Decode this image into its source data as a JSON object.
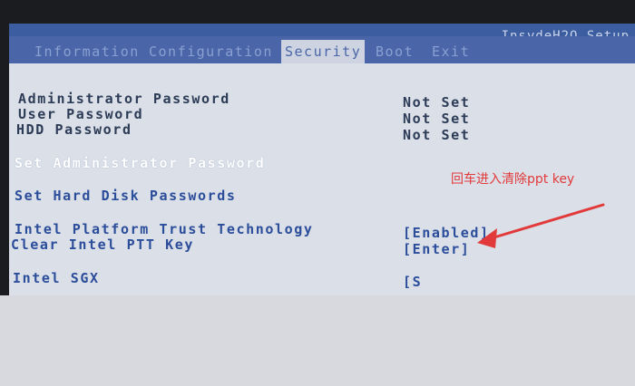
{
  "vendor": "InsydeH2O Setup",
  "menu": {
    "tabs": [
      {
        "label": "Information"
      },
      {
        "label": "Configuration"
      },
      {
        "label": "Security"
      },
      {
        "label": "Boot"
      },
      {
        "label": "Exit"
      }
    ],
    "active": "Security"
  },
  "security": {
    "admin_password": {
      "label": "Administrator Password",
      "value": "Not Set"
    },
    "user_password": {
      "label": "User Password",
      "value": "Not Set"
    },
    "hdd_password": {
      "label": "HDD Password",
      "value": "Not Set"
    },
    "set_admin_password": {
      "label": "Set Administrator Password"
    },
    "set_hdd_passwords": {
      "label": "Set Hard Disk Passwords"
    },
    "ptt": {
      "label": "Intel Platform Trust Technology",
      "value": "[Enabled]"
    },
    "clear_ptt": {
      "label": "Clear Intel PTT Key",
      "value": "[Enter]"
    },
    "sgx": {
      "label": "Intel SGX",
      "value": "[S"
    }
  },
  "annotation": {
    "text": "回车进入清除ppt key",
    "color": "#e23a3a"
  }
}
